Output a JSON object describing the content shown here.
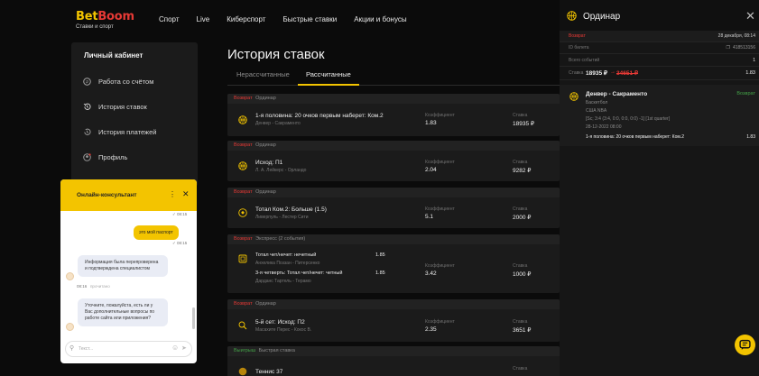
{
  "header": {
    "logo_a": "Bet",
    "logo_b": "Boom",
    "logo_sub": "Ставки и спорт",
    "nav": [
      "Спорт",
      "Live",
      "Киберспорт",
      "Быстрые ставки",
      "Акции и бонусы"
    ]
  },
  "sidebar": {
    "title": "Личный кабинет",
    "items": [
      "Работа со счётом",
      "История ставок",
      "История платежей",
      "Профиль"
    ]
  },
  "main": {
    "title": "История ставок",
    "tabs": [
      "Нерассчитанные",
      "Рассчитанные"
    ],
    "coef_label": "Коэффициент",
    "stake_label": "Ставка",
    "bets": [
      {
        "status": "Возврат",
        "type": "Ординар",
        "name": "1-я половина: 20 очков первым наберет: Ком.2",
        "sub": "Денвер - Сакраменто",
        "coef": "1.83",
        "stake": "18935 ₽"
      },
      {
        "status": "Возврат",
        "type": "Ординар",
        "name": "Исход: П1",
        "sub": "Л. А. Лейкерс - Орландо",
        "coef": "2.04",
        "stake": "9282 ₽"
      },
      {
        "status": "Возврат",
        "type": "Ординар",
        "name": "Тотал Ком.2: Больше (1.5)",
        "sub": "Ливерпуль - Лестер Сити",
        "coef": "5.1",
        "stake": "2000 ₽"
      },
      {
        "status": "Возврат",
        "type": "Экспресс (2 события)",
        "legs": [
          {
            "name": "Тотал чет/нечет: нечетный",
            "sub": "Анхелика Поззан - Питерсенко",
            "coef": "1.85"
          },
          {
            "name": "3-я четверть: Тотал чет/нечет: четный",
            "sub": "Дарданс Тартель - Терамо",
            "coef": "1.85"
          }
        ],
        "coef": "3.42",
        "stake": "1000 ₽"
      },
      {
        "status": "Возврат",
        "type": "Ординар",
        "name": "5-й сет: Исход: П2",
        "sub": "Масахите Перес - Кокос В.",
        "coef": "2.35",
        "stake": "3651 ₽"
      },
      {
        "status": "Выигрыш",
        "type": "Быстрая ставка",
        "name": "Теннис 37",
        "sub": "",
        "coef": "",
        "stake": ""
      }
    ]
  },
  "coupon": {
    "title": "Ординар",
    "status": "Возврат",
    "date": "28 декабря, 08:14",
    "id_label": "ID билета",
    "id_value": "418513156",
    "events_label": "Всего событий",
    "events_value": "1",
    "stake_label": "Ставка",
    "stake_value": "18935 ₽",
    "arrow": "→",
    "payout_value": "34651 ₽",
    "coef_value": "1.83",
    "event": {
      "name": "Денвер - Сакраменто",
      "status": "Возврат",
      "sport": "Баскетбол",
      "league": "США NBA",
      "score": "[Sc; 3:4 (3:4, 0:0, 0:0, 0:0) -1] [1st quarter]",
      "time": "28-12-2022 08:00",
      "market": "1-я половина: 20 очков первым наберет: Ком.2",
      "coef": "1.83"
    }
  },
  "chat": {
    "title": "Онлайн-консультант",
    "ts_top": "08:15",
    "msg_out": "это мой паспорт",
    "ts_out": "08:15",
    "msg_in1": "Информация была перепроверена и подтверждена специалистом",
    "ts_in1": "08:16",
    "ts_in1_tag": "прочитано",
    "msg_in2": "Уточните, пожалуйста, есть ли у Вас дополнительные вопросы по работе сайта или приложения?",
    "input_placeholder": "Текст..."
  },
  "colors": {
    "accent": "#f3c400",
    "refund": "#e53935",
    "win": "#43a047",
    "bg": "#0b0b0b",
    "card": "#1b1b1b"
  }
}
